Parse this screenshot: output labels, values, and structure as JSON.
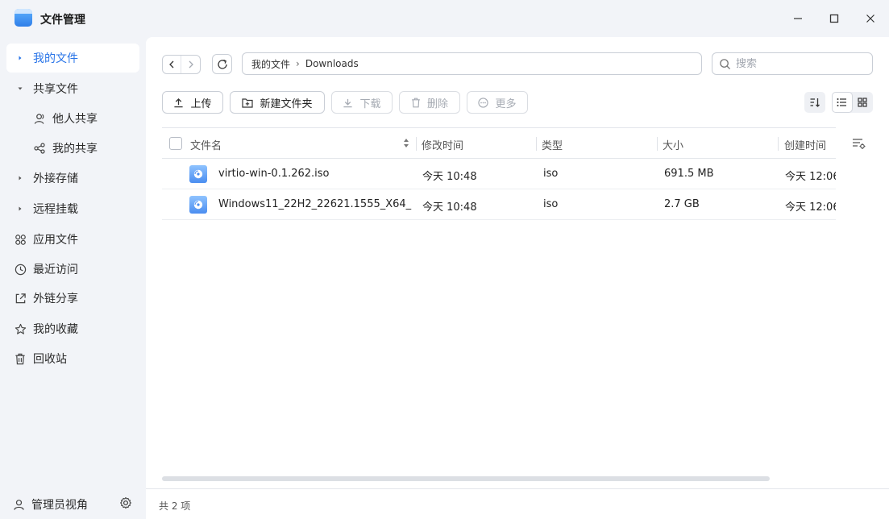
{
  "window": {
    "title": "文件管理"
  },
  "sidebar": {
    "items": [
      {
        "label": "我的文件",
        "icon": "caret-right-icon",
        "active": true
      },
      {
        "label": "共享文件",
        "icon": "caret-down-icon"
      },
      {
        "label": "他人共享",
        "icon": "user-icon",
        "sub": true
      },
      {
        "label": "我的共享",
        "icon": "share-icon",
        "sub": true
      },
      {
        "label": "外接存储",
        "icon": "caret-right-icon"
      },
      {
        "label": "远程挂载",
        "icon": "caret-right-icon"
      },
      {
        "label": "应用文件",
        "icon": "apps-icon"
      },
      {
        "label": "最近访问",
        "icon": "clock-icon"
      },
      {
        "label": "外链分享",
        "icon": "external-link-icon"
      },
      {
        "label": "我的收藏",
        "icon": "star-icon"
      },
      {
        "label": "回收站",
        "icon": "trash-icon"
      }
    ],
    "footer": {
      "admin_label": "管理员视角"
    }
  },
  "toolbar": {
    "breadcrumb": [
      "我的文件",
      "Downloads"
    ],
    "search_placeholder": "搜索",
    "upload_label": "上传",
    "new_folder_label": "新建文件夹",
    "download_label": "下载",
    "delete_label": "删除",
    "more_label": "更多"
  },
  "table": {
    "columns": [
      "文件名",
      "修改时间",
      "类型",
      "大小",
      "创建时间"
    ],
    "rows": [
      {
        "name": "virtio-win-0.1.262.iso",
        "modified": "今天 10:48",
        "type": "iso",
        "size": "691.5 MB",
        "created": "今天 12:06"
      },
      {
        "name": "Windows11_22H2_22621.1555_X64_...",
        "modified": "今天 10:48",
        "type": "iso",
        "size": "2.7 GB",
        "created": "今天 12:06"
      }
    ]
  },
  "status": {
    "count_text": "共 2 项"
  },
  "colors": {
    "accent": "#2874e8",
    "sidebar_bg": "#f2f4f8",
    "panel_bg": "#ffffff"
  }
}
